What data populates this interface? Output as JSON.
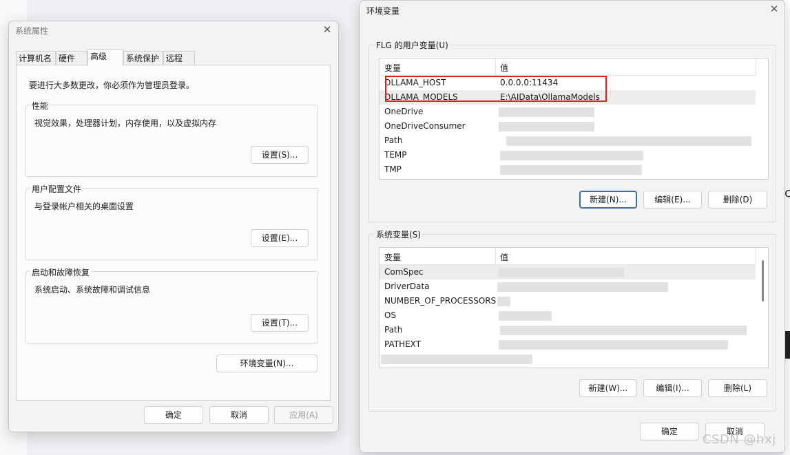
{
  "sysprops": {
    "title": "系统属性",
    "tabs": [
      {
        "label": "计算机名"
      },
      {
        "label": "硬件"
      },
      {
        "label": "高级"
      },
      {
        "label": "系统保护"
      },
      {
        "label": "远程"
      }
    ],
    "admin_note": "要进行大多数更改，你必须作为管理员登录。",
    "performance": {
      "legend": "性能",
      "desc": "视觉效果，处理器计划，内存使用，以及虚拟内存",
      "button": "设置(S)..."
    },
    "profile": {
      "legend": "用户配置文件",
      "desc": "与登录帐户相关的桌面设置",
      "button": "设置(E)..."
    },
    "startup": {
      "legend": "启动和故障恢复",
      "desc": "系统启动、系统故障和调试信息",
      "button": "设置(T)..."
    },
    "env_button": "环境变量(N)...",
    "ok": "确定",
    "cancel": "取消",
    "apply": "应用(A)"
  },
  "envvars": {
    "title": "环境变量",
    "user_section": "FLG 的用户变量(U)",
    "system_section": "系统变量(S)",
    "col_var": "变量",
    "col_val": "值",
    "user_vars": [
      {
        "name": "OLLAMA_HOST",
        "value": "0.0.0.0:11434"
      },
      {
        "name": "OLLAMA_MODELS",
        "value": "E:\\AIData\\OllamaModels"
      },
      {
        "name": "OneDrive",
        "value": ""
      },
      {
        "name": "OneDriveConsumer",
        "value": ""
      },
      {
        "name": "Path",
        "value": ""
      },
      {
        "name": "TEMP",
        "value": ""
      },
      {
        "name": "TMP",
        "value": ""
      }
    ],
    "system_vars": [
      {
        "name": "ComSpec",
        "value": ""
      },
      {
        "name": "DriverData",
        "value": ""
      },
      {
        "name": "NUMBER_OF_PROCESSORS",
        "value": ""
      },
      {
        "name": "OS",
        "value": ""
      },
      {
        "name": "Path",
        "value": ""
      },
      {
        "name": "PATHEXT",
        "value": ""
      }
    ],
    "user_buttons": {
      "new": "新建(N)...",
      "edit": "编辑(E)...",
      "delete": "删除(D)"
    },
    "system_buttons": {
      "new": "新建(W)...",
      "edit": "编辑(I)...",
      "delete": "删除(L)"
    },
    "ok": "确定",
    "cancel": "取消"
  },
  "icons": {
    "close": "close-icon"
  },
  "colors": {
    "highlight": "#e02020",
    "primary_border": "#3a6fb0"
  },
  "watermark": "CSDN @hxj"
}
